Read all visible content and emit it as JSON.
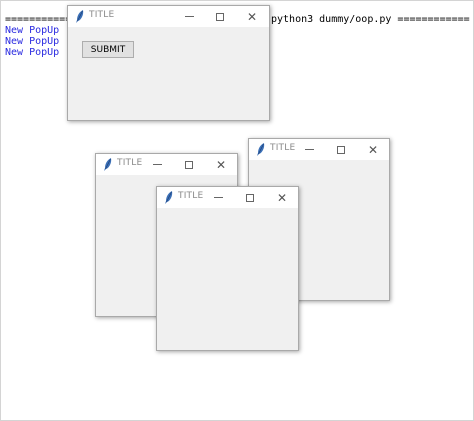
{
  "console": {
    "separator_left": "=============",
    "separator_right": "python3 dummy/oop.py ============",
    "lines": [
      "New PopUp",
      "New PopUp",
      "New PopUp"
    ]
  },
  "windows": [
    {
      "title": "TITLE",
      "button_label": "SUBMIT"
    },
    {
      "title": "TITLE"
    },
    {
      "title": "TITLE"
    },
    {
      "title": "TITLE"
    }
  ],
  "icons": {
    "app": "feather-icon",
    "minimize": "minimize-icon",
    "maximize": "maximize-icon",
    "close": "close-icon"
  },
  "colors": {
    "popup_text": "#2a2ae0",
    "window_bg": "#f0f0f0",
    "titlebar_bg": "#ffffff"
  }
}
